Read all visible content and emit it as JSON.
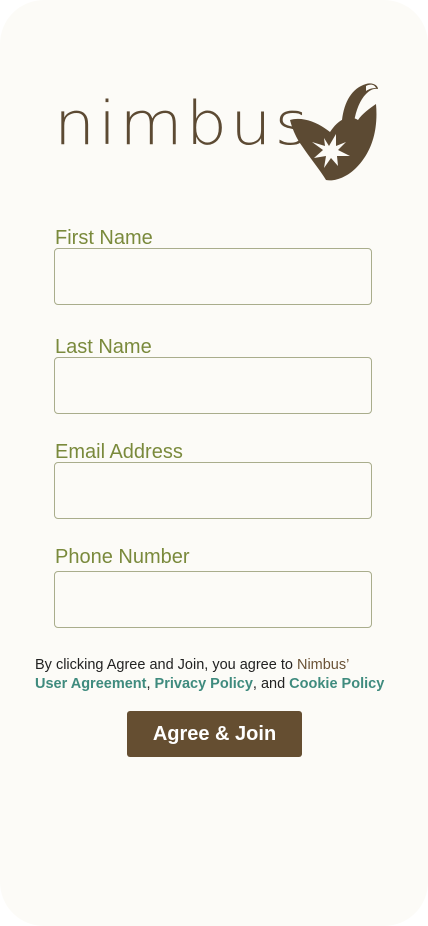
{
  "brand": {
    "name": "nimbus",
    "logo_icon": "leaf-with-starburst-icon",
    "color": "#5c4a33"
  },
  "form": {
    "fields": [
      {
        "label": "First Name",
        "value": "",
        "placeholder": ""
      },
      {
        "label": "Last Name",
        "value": "",
        "placeholder": ""
      },
      {
        "label": "Email Address",
        "value": "",
        "placeholder": ""
      },
      {
        "label": "Phone Number",
        "value": "",
        "placeholder": ""
      }
    ],
    "label_color": "#7a8a3c"
  },
  "legal": {
    "prefix": "By clicking Agree and Join, you agree to ",
    "brand_possessive": "Nimbus’",
    "user_agreement": "User Agreement",
    "comma": ", ",
    "privacy_policy": "Privacy Policy",
    "and": ", and ",
    "cookie_policy": "Cookie Policy",
    "link_color": "#3f8b7e"
  },
  "actions": {
    "agree_join_label": "Agree & Join",
    "button_color": "#654e31"
  }
}
